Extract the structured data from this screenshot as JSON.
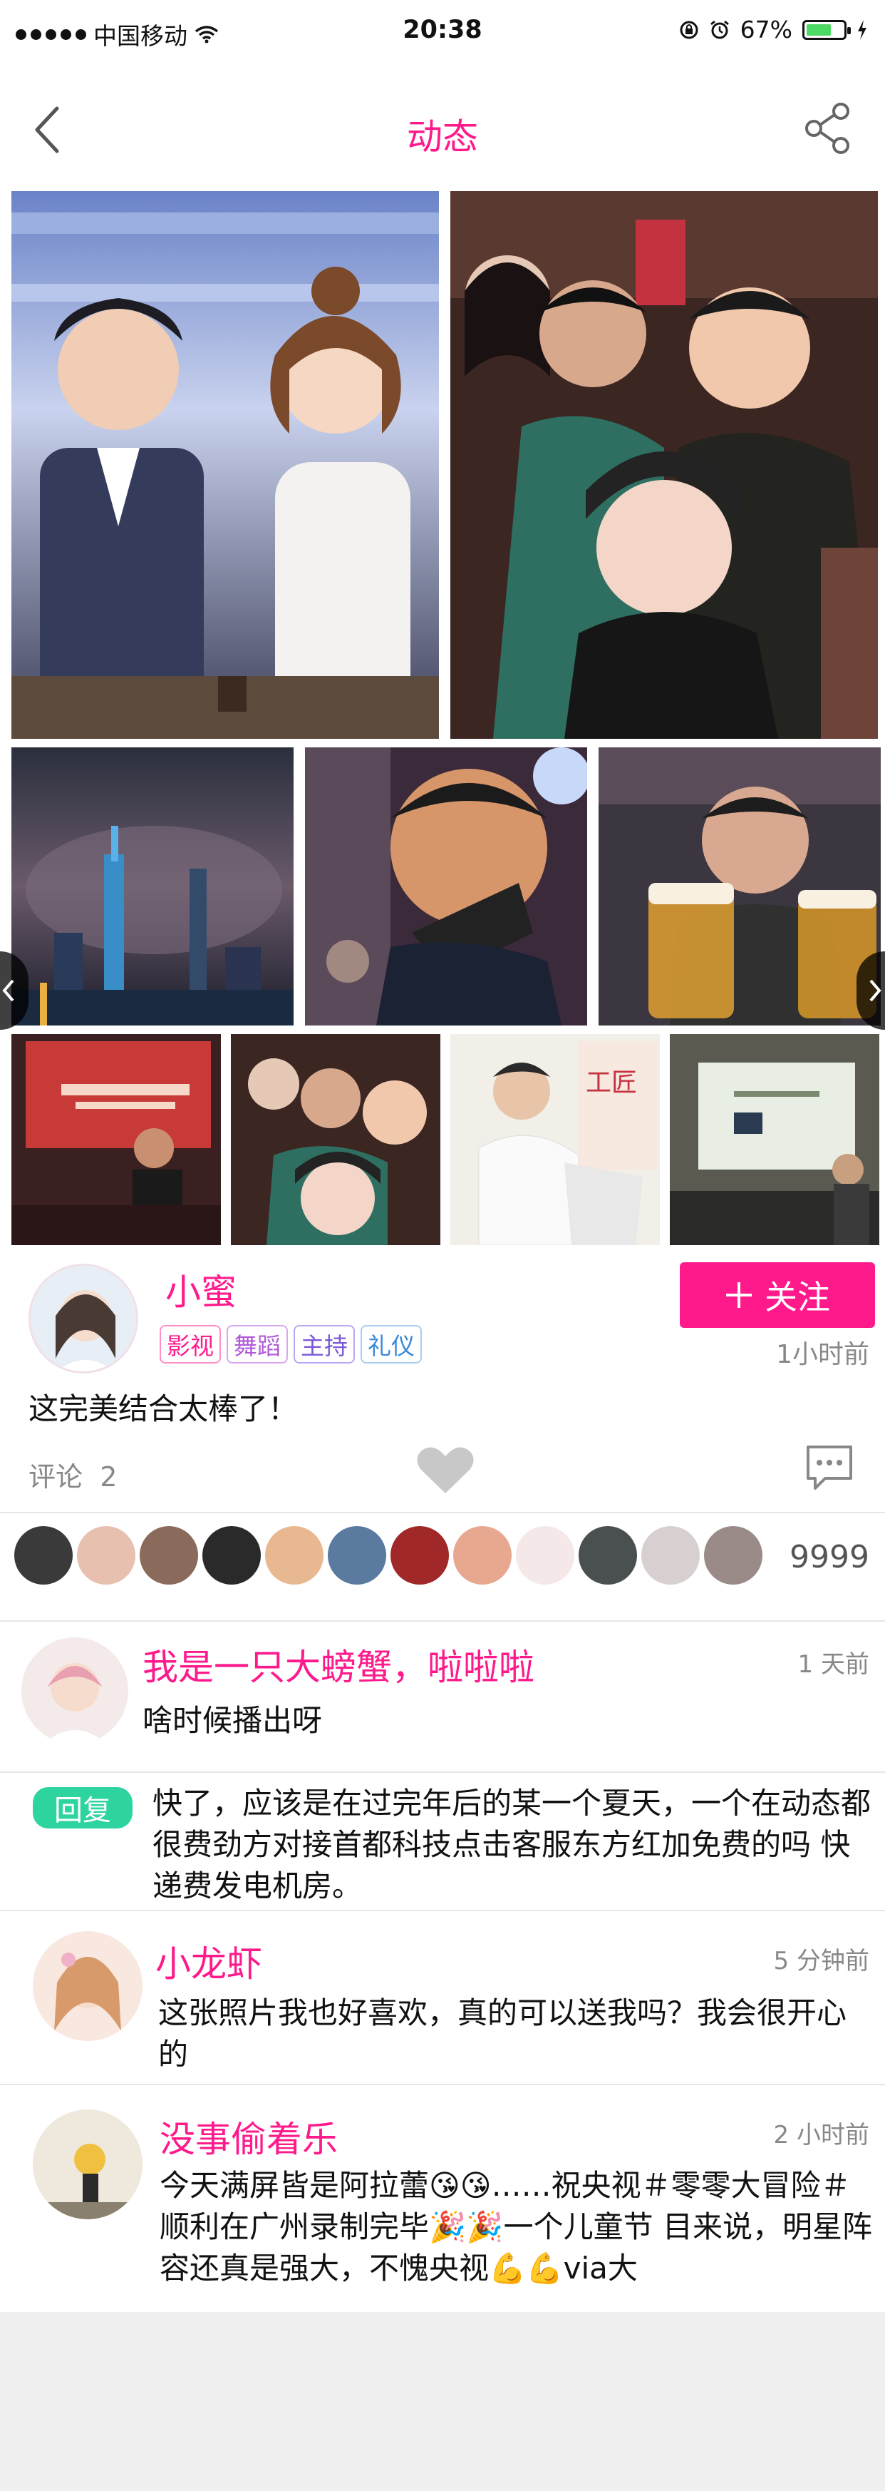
{
  "status_bar": {
    "carrier": "中国移动",
    "time": "20:38",
    "battery": "67%",
    "battery_level": 0.67
  },
  "nav": {
    "title": "动态"
  },
  "post": {
    "author": "小蜜",
    "tags": [
      "影视",
      "舞蹈",
      "主持",
      "礼仪"
    ],
    "follow_label": "关注",
    "time": "1小时前",
    "text": "这完美结合太棒了！",
    "comment_label": "评论",
    "comment_count": "2",
    "like_total": "9999"
  },
  "comments": [
    {
      "name": "我是一只大螃蟹，啦啦啦",
      "time": "1 天前",
      "text": "啥时候播出呀"
    },
    {
      "reply_label": "回复",
      "text": "快了，应该是在过完年后的某一个夏天，一个在动态都很费劲方对接首都科技点击客服东方红加免费的吗 快递费发电机房。"
    },
    {
      "name": "小龙虾",
      "time": "5 分钟前",
      "text": "这张照片我也好喜欢，真的可以送我吗？我会很开心的"
    },
    {
      "name": "没事偷着乐",
      "time": "2 小时前",
      "text": "今天满屏皆是阿拉蕾😘😘……祝央视＃零零大冒险＃顺利在广州录制完毕🎉🎉一个儿童节 目来说，明星阵容还真是强大，不愧央视💪💪via大"
    }
  ],
  "colors": {
    "accent": "#ff1a8c",
    "reply_badge": "#2ed4a0"
  }
}
